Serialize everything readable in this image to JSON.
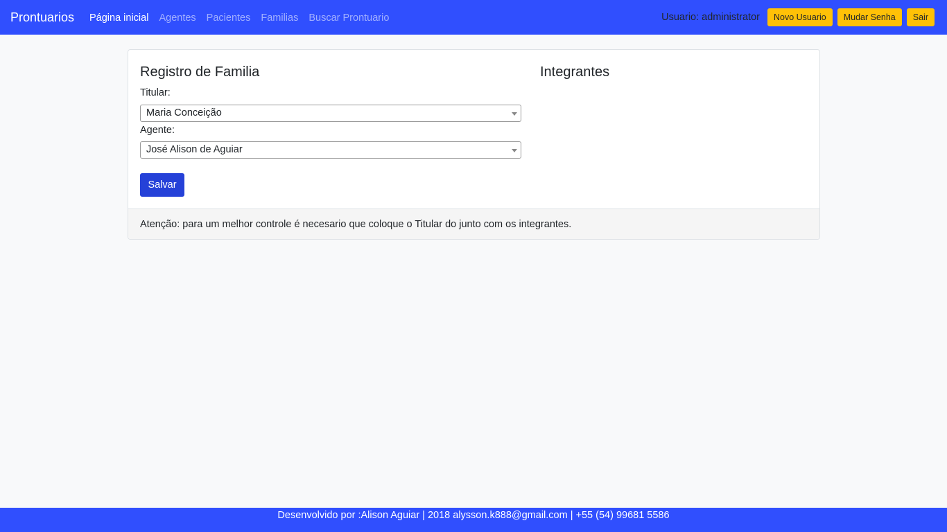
{
  "navbar": {
    "brand": "Prontuarios",
    "links": [
      {
        "label": "Página inicial"
      },
      {
        "label": "Agentes"
      },
      {
        "label": "Pacientes"
      },
      {
        "label": "Familias"
      },
      {
        "label": "Buscar Prontuario"
      }
    ],
    "user_label": "Usuario: administrator",
    "new_user_label": "Novo Usuario",
    "change_password_label": "Mudar Senha",
    "logout_label": "Sair"
  },
  "form": {
    "title": "Registro de Familia",
    "titular_label": "Titular:",
    "titular_value": "Maria Conceição",
    "agente_label": "Agente:",
    "agente_value": "José Alison de Aguiar",
    "save_label": "Salvar"
  },
  "members": {
    "title": "Integrantes"
  },
  "card_footer": {
    "notice": "Atenção: para um melhor controle é necesario que coloque o Titular do junto com os integrantes."
  },
  "footer": {
    "text": "Desenvolvido por :Alison Aguiar | 2018 alysson.k888@gmail.com | +55 (54) 99681 5586"
  },
  "colors": {
    "navbar": "#304ffe",
    "accent_button": "#ffc107",
    "primary_button": "#2541d8"
  }
}
